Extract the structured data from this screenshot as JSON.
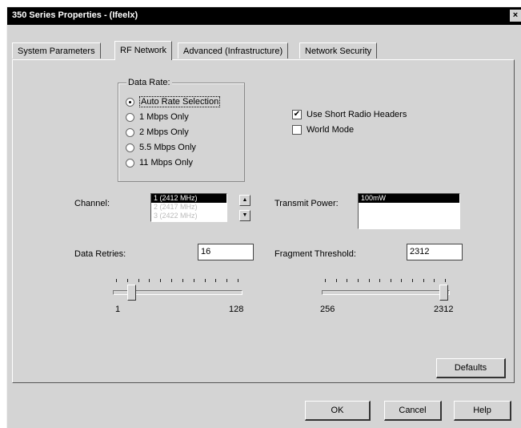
{
  "window": {
    "title": "350 Series Properties - (Ifeelx)",
    "close_glyph": "×"
  },
  "tabs": [
    {
      "label": "System Parameters",
      "active": false
    },
    {
      "label": "RF Network",
      "active": true
    },
    {
      "label": "Advanced (Infrastructure)",
      "active": false
    },
    {
      "label": "Network Security",
      "active": false
    }
  ],
  "data_rate": {
    "group_label": "Data Rate:",
    "options": [
      {
        "label": "Auto Rate Selection",
        "selected": true
      },
      {
        "label": "1 Mbps Only",
        "selected": false
      },
      {
        "label": "2 Mbps Only",
        "selected": false
      },
      {
        "label": "5.5 Mbps Only",
        "selected": false
      },
      {
        "label": "11 Mbps Only",
        "selected": false
      }
    ]
  },
  "checkboxes": [
    {
      "label": "Use Short Radio Headers",
      "checked": true
    },
    {
      "label": "World Mode",
      "checked": false
    }
  ],
  "channel": {
    "label": "Channel:",
    "items": [
      "1 (2412 MHz)",
      "2 (2417 MHz)",
      "3 (2422 MHz)"
    ],
    "selected_index": 0,
    "scroll_up": "▲",
    "scroll_down": "▼"
  },
  "transmit_power": {
    "label": "Transmit Power:",
    "items": [
      "100mW"
    ],
    "selected_index": 0
  },
  "data_retries": {
    "label": "Data Retries:",
    "value": "16",
    "slider": {
      "min_label": "1",
      "max_label": "128",
      "min": 1,
      "max": 128,
      "value": 16
    }
  },
  "fragment_threshold": {
    "label": "Fragment Threshold:",
    "value": "2312",
    "slider": {
      "min_label": "256",
      "max_label": "2312",
      "min": 256,
      "max": 2312,
      "value": 2312
    }
  },
  "buttons": {
    "defaults": "Defaults",
    "ok": "OK",
    "cancel": "Cancel",
    "help": "Help"
  }
}
